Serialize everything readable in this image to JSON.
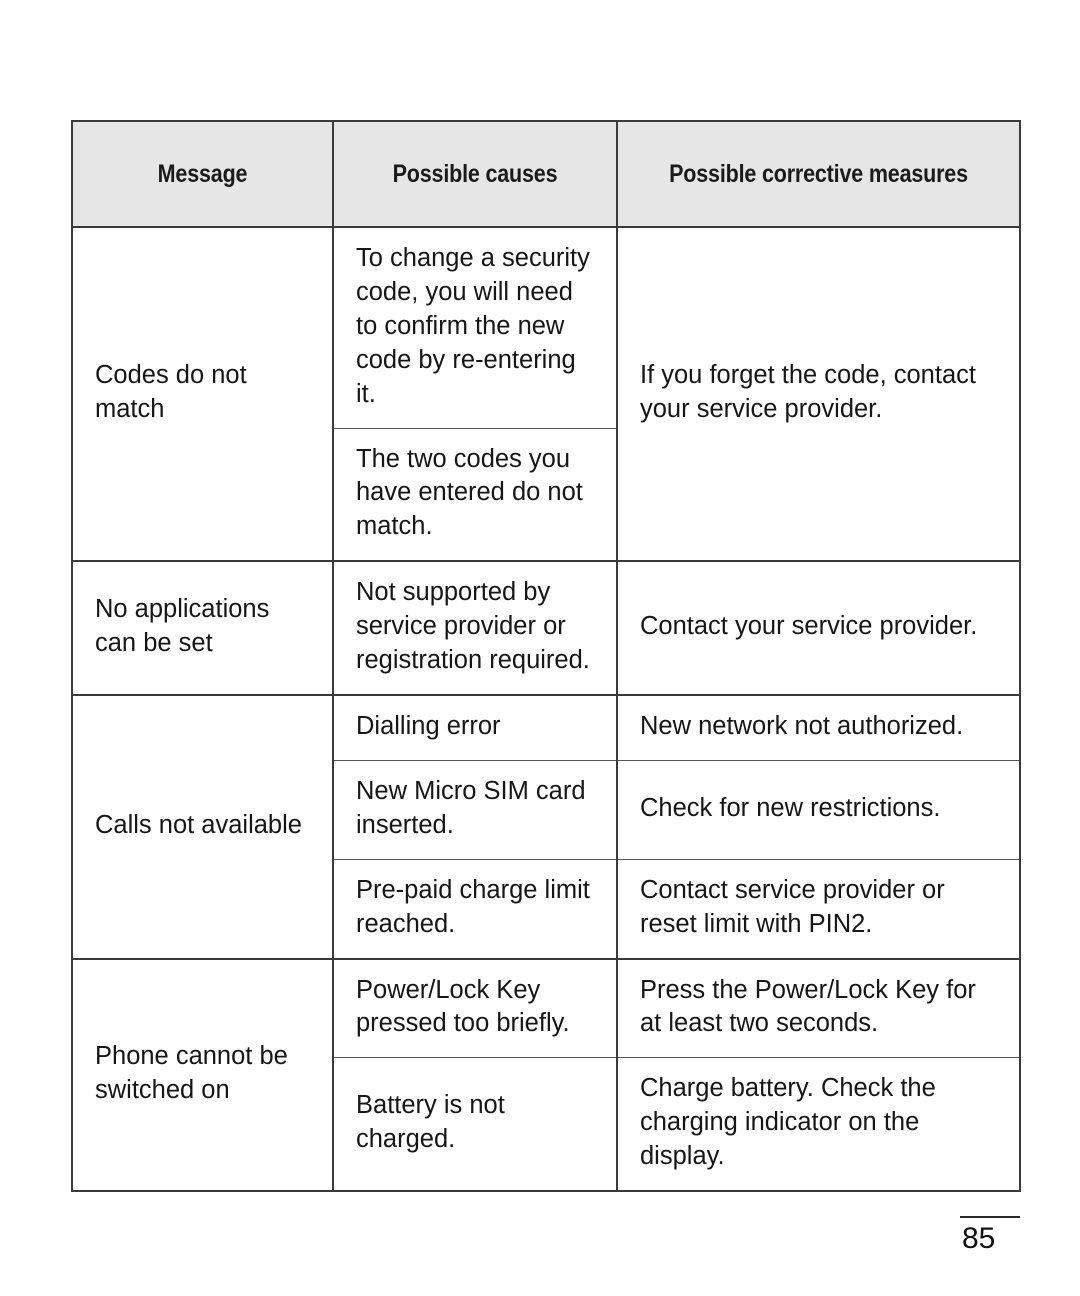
{
  "page": {
    "number": "85",
    "background_color": "#ffffff",
    "text_color": "#161616"
  },
  "table": {
    "header_background": "#e6e6e6",
    "border_color": "#3a3a3a",
    "columns": [
      {
        "key": "message",
        "label": "Message"
      },
      {
        "key": "causes",
        "label": "Possible causes"
      },
      {
        "key": "measures",
        "label": "Possible corrective measures"
      }
    ],
    "rows": [
      {
        "message": "Codes do not\nmatch",
        "measure_merged": "If you forget the code, contact\nyour service provider.",
        "causes": [
          "To change a security\ncode, you will need\nto confirm the new\ncode by re-entering\nit.",
          "The two codes you\nhave entered do not\nmatch."
        ]
      },
      {
        "message": "No applications\ncan be set",
        "pairs": [
          {
            "cause": "Not supported by\nservice provider or\nregistration required.",
            "measure": "Contact your service provider."
          }
        ]
      },
      {
        "message": "Calls not available",
        "pairs": [
          {
            "cause": "Dialling error",
            "measure": "New network not authorized."
          },
          {
            "cause": "New Micro SIM card\ninserted.",
            "measure": "Check for new restrictions."
          },
          {
            "cause": "Pre-paid charge limit\nreached.",
            "measure": "Contact service provider or\nreset limit with PIN2."
          }
        ]
      },
      {
        "message": "Phone cannot be\nswitched on",
        "pairs": [
          {
            "cause": "Power/Lock Key\npressed too briefly.",
            "measure": "Press the Power/Lock Key for\nat least two seconds."
          },
          {
            "cause": "Battery is not\ncharged.",
            "measure": "Charge battery. Check the\ncharging indicator on the\ndisplay."
          }
        ]
      }
    ]
  }
}
